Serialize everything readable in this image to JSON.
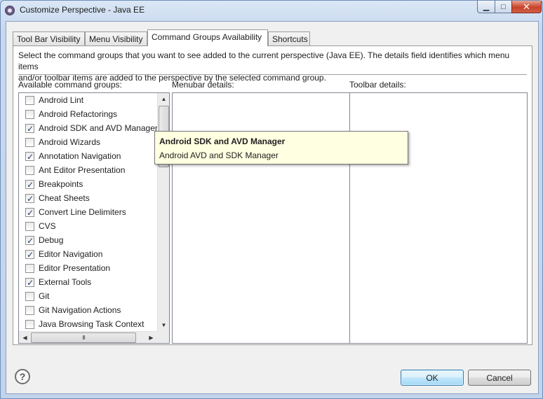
{
  "window": {
    "title": "Customize Perspective - Java EE",
    "controls": {
      "minimize": "▁",
      "maximize": "□",
      "close": "✕"
    }
  },
  "tabs": [
    {
      "label": "Tool Bar Visibility",
      "active": false
    },
    {
      "label": "Menu Visibility",
      "active": false
    },
    {
      "label": "Command Groups Availability",
      "active": true
    },
    {
      "label": "Shortcuts",
      "active": false
    }
  ],
  "panel": {
    "description_line1": "Select the command groups that you want to see added to the current perspective (Java EE).  The details field identifies which menu items",
    "description_line2": "and/or toolbar items are added to the perspective by the selected command group.",
    "available_label": "Available command groups:",
    "menubar_label": "Menubar details:",
    "toolbar_label": "Toolbar details:"
  },
  "command_groups": [
    {
      "label": "Android Lint",
      "checked": false
    },
    {
      "label": "Android Refactorings",
      "checked": false
    },
    {
      "label": "Android SDK and AVD Manager",
      "checked": true
    },
    {
      "label": "Android Wizards",
      "checked": false
    },
    {
      "label": "Annotation Navigation",
      "checked": true
    },
    {
      "label": "Ant Editor Presentation",
      "checked": false
    },
    {
      "label": "Breakpoints",
      "checked": true
    },
    {
      "label": "Cheat Sheets",
      "checked": true
    },
    {
      "label": "Convert Line Delimiters",
      "checked": true
    },
    {
      "label": "CVS",
      "checked": false
    },
    {
      "label": "Debug",
      "checked": true
    },
    {
      "label": "Editor Navigation",
      "checked": true
    },
    {
      "label": "Editor Presentation",
      "checked": false
    },
    {
      "label": "External Tools",
      "checked": true
    },
    {
      "label": "Git",
      "checked": false
    },
    {
      "label": "Git Navigation Actions",
      "checked": false
    },
    {
      "label": "Java Browsing Task Context",
      "checked": false
    }
  ],
  "scrollbars": {
    "up": "▲",
    "down": "▼",
    "left": "◀",
    "right": "▶",
    "grip": "III"
  },
  "tooltip": {
    "title": "Android SDK and AVD Manager",
    "body": "Android AVD and SDK Manager"
  },
  "footer": {
    "help": "?",
    "ok_label": "OK",
    "cancel_label": "Cancel"
  }
}
